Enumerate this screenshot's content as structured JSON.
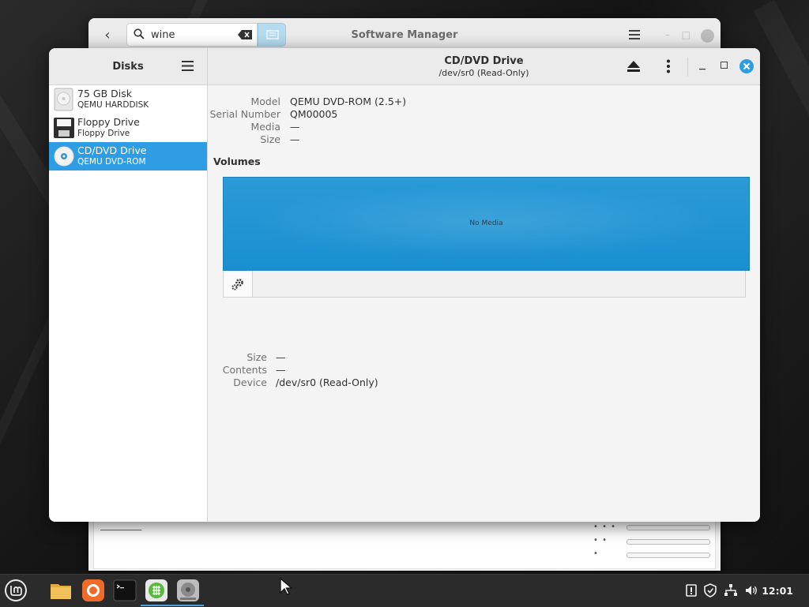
{
  "background_window": {
    "title": "Software Manager",
    "search": {
      "value": "wine"
    },
    "star_rows": [
      "• • •",
      "• •",
      "•"
    ]
  },
  "disks_window": {
    "sidebar": {
      "title": "Disks",
      "items": [
        {
          "name": "75 GB Disk",
          "subtitle": "QEMU HARDDISK",
          "icon": "hard-disk-icon",
          "selected": false
        },
        {
          "name": "Floppy Drive",
          "subtitle": "Floppy Drive",
          "icon": "floppy-icon",
          "selected": false
        },
        {
          "name": "CD/DVD Drive",
          "subtitle": "QEMU DVD-ROM",
          "icon": "optical-disc-icon",
          "selected": true
        }
      ]
    },
    "header": {
      "title": "CD/DVD Drive",
      "subtitle": "/dev/sr0 (Read-Only)"
    },
    "drive_info": [
      {
        "label": "Model",
        "value": "QEMU DVD-ROM (2.5+)"
      },
      {
        "label": "Serial Number",
        "value": "QM00005"
      },
      {
        "label": "Media",
        "value": "—"
      },
      {
        "label": "Size",
        "value": "—"
      }
    ],
    "volumes": {
      "heading": "Volumes",
      "empty_label": "No Media"
    },
    "volume_info": [
      {
        "label": "Size",
        "value": "—"
      },
      {
        "label": "Contents",
        "value": "—"
      },
      {
        "label": "Device",
        "value": "/dev/sr0 (Read-Only)"
      }
    ]
  },
  "taskbar": {
    "clock": "12:01"
  },
  "colors": {
    "accent": "#2f9de3",
    "volume_fill": "#1f95d5"
  }
}
